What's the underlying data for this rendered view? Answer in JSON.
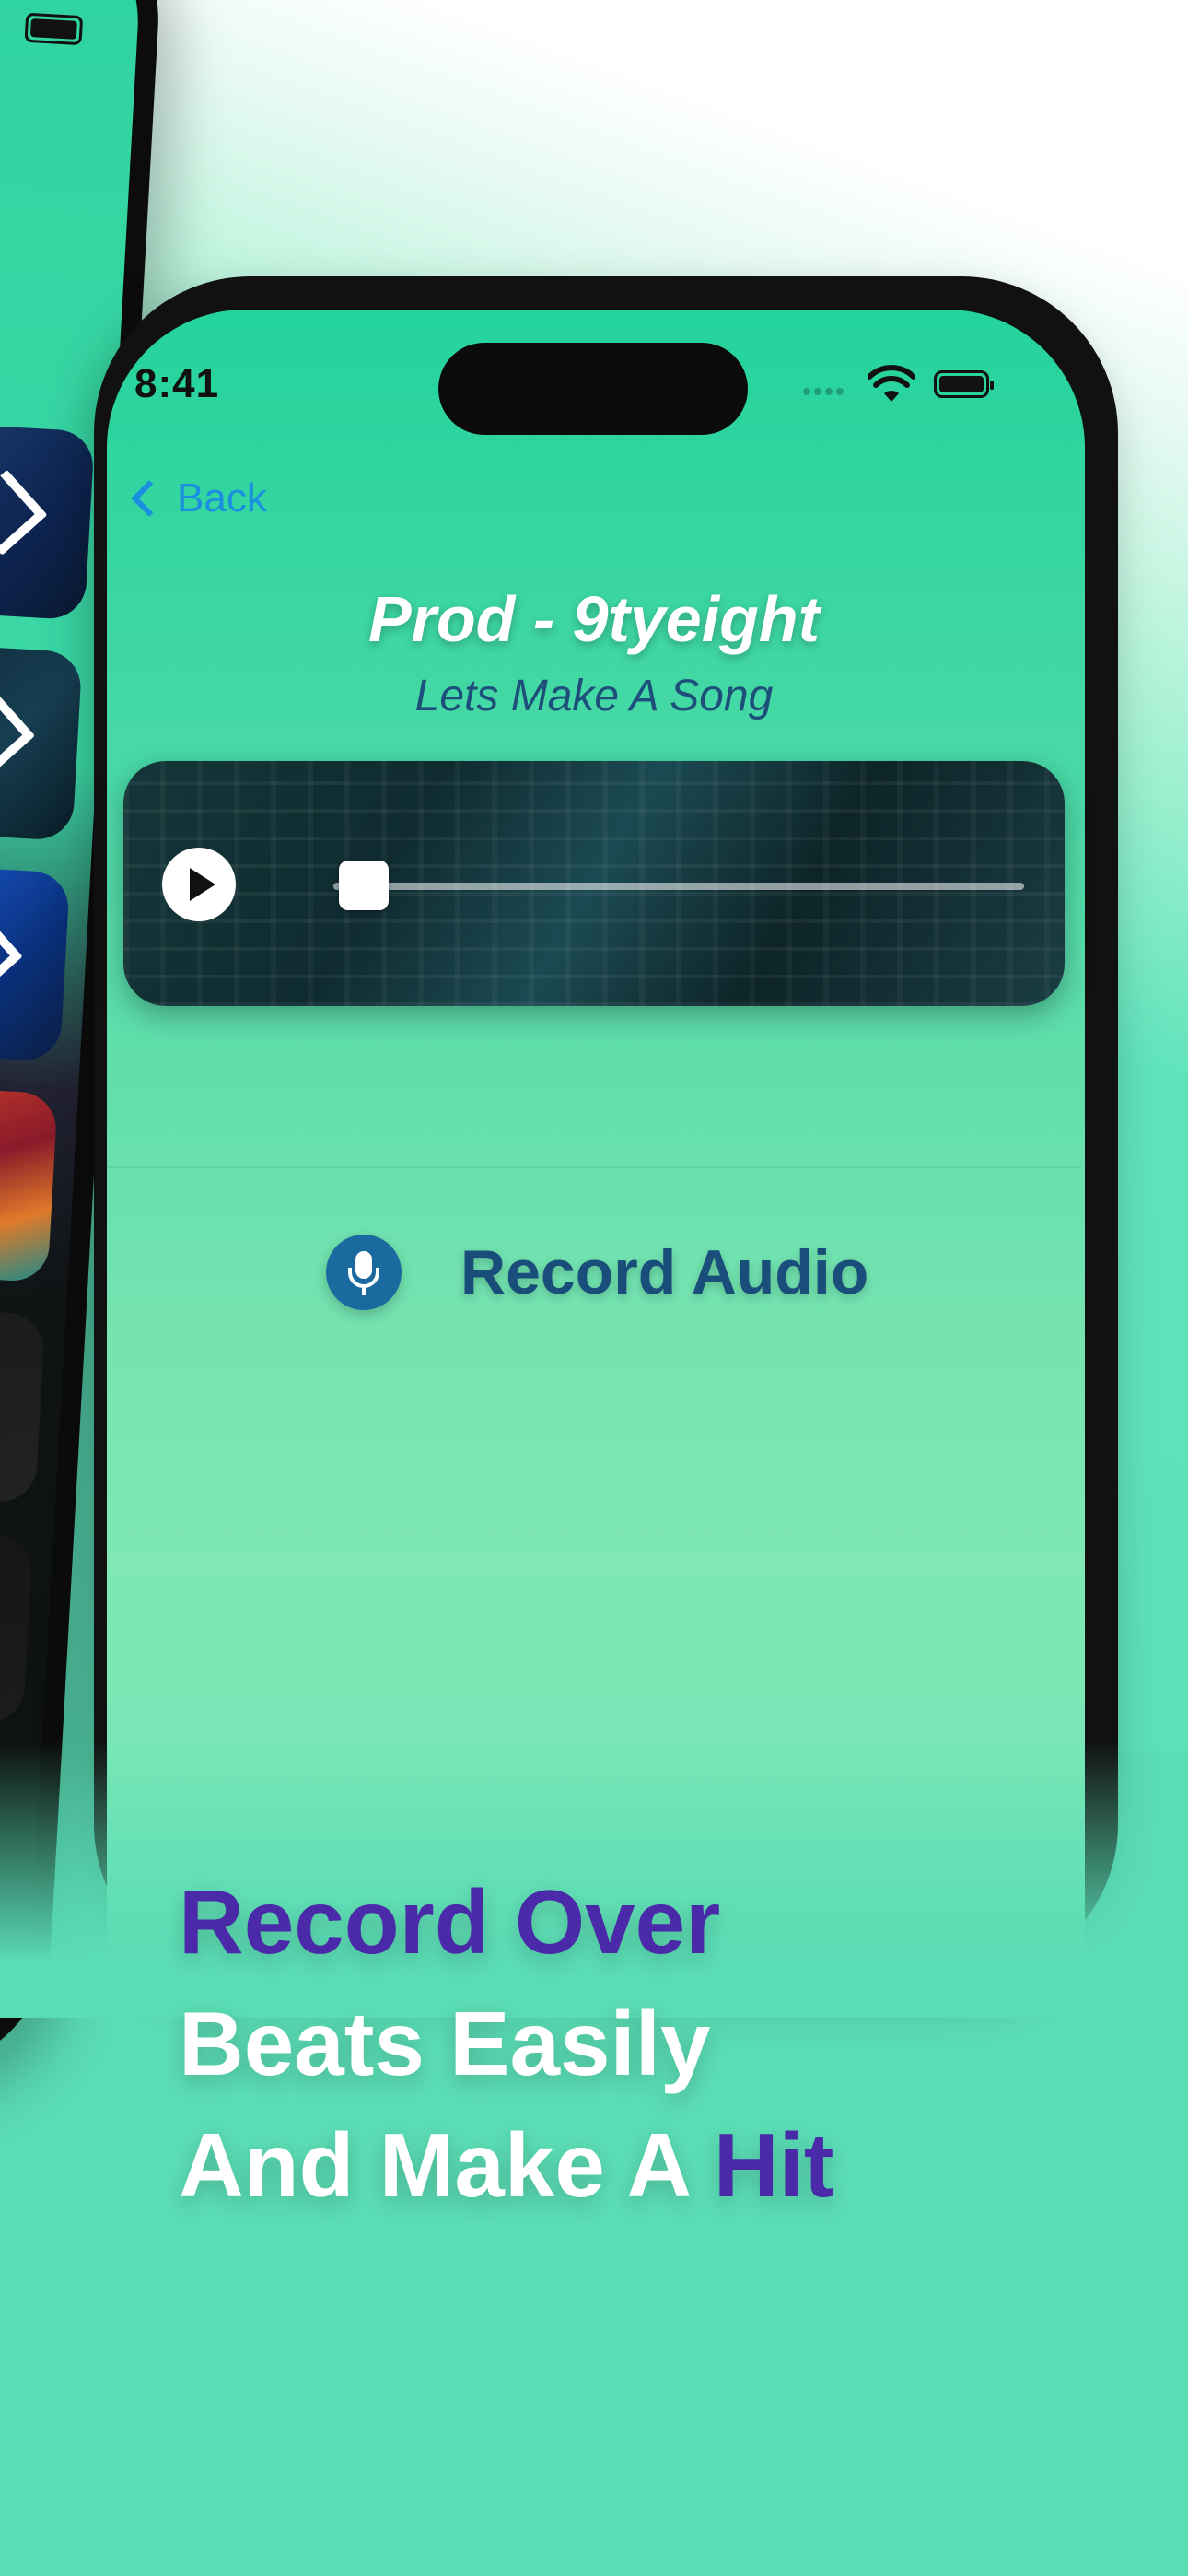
{
  "status_bar": {
    "time": "8:41"
  },
  "nav": {
    "back_label": "Back"
  },
  "song": {
    "title": "Prod - 9tyeight",
    "subtitle": "Lets Make A Song"
  },
  "player": {
    "progress": 0.0
  },
  "record": {
    "label": "Record Audio"
  },
  "headline": {
    "line1": "Record Over",
    "line2": "Beats Easily",
    "line3_prefix": "And Make A ",
    "line3_highlight": "Hit"
  },
  "colors": {
    "accent_purple": "#4a2aa8",
    "back_blue": "#1a8fe0",
    "record_blue": "#1a4e7a",
    "background_green": "#5adcb4"
  },
  "icons": [
    "wifi-icon",
    "battery-icon",
    "play-icon",
    "microphone-icon",
    "chevron-left-icon",
    "chevron-right-icon"
  ]
}
